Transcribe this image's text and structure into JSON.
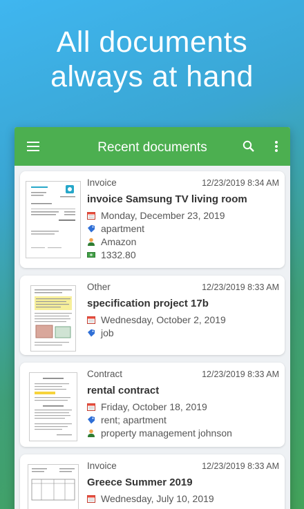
{
  "hero": {
    "line1": "All documents",
    "line2": "always at hand"
  },
  "appbar": {
    "title": "Recent documents",
    "menu_icon": "hamburger-menu-icon",
    "search_icon": "search-icon",
    "more_icon": "more-vert-icon",
    "color": "#4caf50"
  },
  "documents": [
    {
      "type": "Invoice",
      "timestamp": "12/23/2019 8:34 AM",
      "title": "invoice Samsung TV living room",
      "date": "Monday, December 23, 2019",
      "tags": "apartment",
      "contact": "Amazon",
      "amount": "1332.80"
    },
    {
      "type": "Other",
      "timestamp": "12/23/2019 8:33 AM",
      "title": "specification project 17b",
      "date": "Wednesday, October 2, 2019",
      "tags": "job"
    },
    {
      "type": "Contract",
      "timestamp": "12/23/2019 8:33 AM",
      "title": "rental contract",
      "date": "Friday, October 18, 2019",
      "tags": "rent; apartment",
      "contact": "property management johnson"
    },
    {
      "type": "Invoice",
      "timestamp": "12/23/2019 8:33 AM",
      "title": "Greece Summer 2019",
      "date": "Wednesday, July 10, 2019"
    }
  ]
}
